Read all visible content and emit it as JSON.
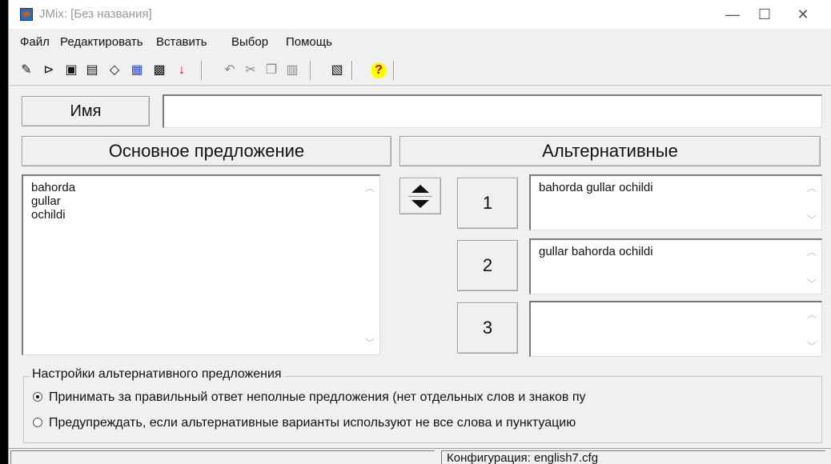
{
  "window": {
    "title": "JMix: [Без названия]",
    "minimize": "—",
    "maximize": "☐",
    "close": "✕"
  },
  "menu": [
    "Файл",
    "Редактировать",
    "Вставить",
    "Выбор",
    "Помощь"
  ],
  "toolbar": {
    "icons": [
      "new-icon",
      "open-icon",
      "save-icon",
      "save-as-icon",
      "erase-icon",
      "shuffle-icon",
      "check-icon",
      "export-icon",
      "undo-icon",
      "cut-icon",
      "copy-icon",
      "paste-icon",
      "config-icon",
      "help-icon"
    ]
  },
  "name_field": {
    "label": "Имя",
    "value": ""
  },
  "main_sentence": {
    "label": "Основное предложение",
    "text": "bahorda\ngullar\nochildi"
  },
  "alternatives": {
    "label": "Альтернативные",
    "items": [
      {
        "number": "1",
        "text": "bahorda gullar ochildi"
      },
      {
        "number": "2",
        "text": "gullar bahorda ochildi"
      },
      {
        "number": "3",
        "text": ""
      }
    ]
  },
  "settings": {
    "title": "Настройки альтернативного предложения",
    "option1": "Принимать за правильный ответ неполные предложения (нет отдельных слов и знаков пу",
    "option2": "Предупреждать, если альтернативные варианты используют не все слова и пунктуацию",
    "selected": 1
  },
  "status": {
    "config": "Конфигурация: english7.cfg"
  }
}
